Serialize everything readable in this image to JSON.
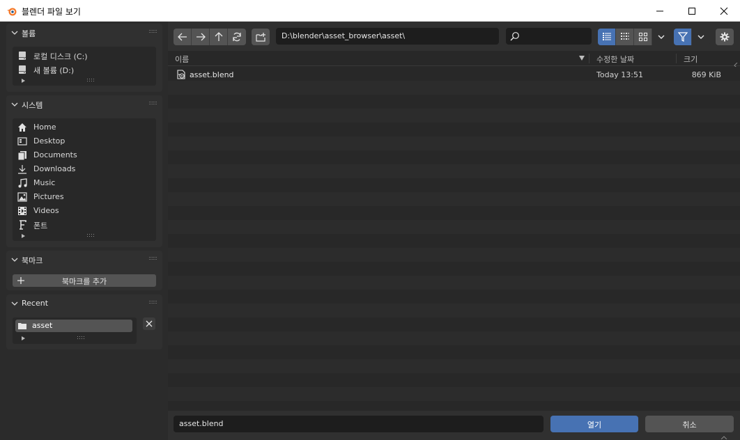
{
  "window": {
    "title": "블렌더 파일 보기",
    "controls": [
      "minimize-icon",
      "maximize-icon",
      "close-icon"
    ]
  },
  "sidebar": {
    "volumes": {
      "title": "볼륨",
      "items": [
        {
          "label": "로컬 디스크 (C:)",
          "icon": "drive-icon"
        },
        {
          "label": "새 볼륨 (D:)",
          "icon": "drive-icon"
        }
      ]
    },
    "system": {
      "title": "시스템",
      "items": [
        {
          "label": "Home",
          "icon": "home-icon"
        },
        {
          "label": "Desktop",
          "icon": "desktop-icon"
        },
        {
          "label": "Documents",
          "icon": "documents-icon"
        },
        {
          "label": "Downloads",
          "icon": "downloads-icon"
        },
        {
          "label": "Music",
          "icon": "music-icon"
        },
        {
          "label": "Pictures",
          "icon": "pictures-icon"
        },
        {
          "label": "Videos",
          "icon": "videos-icon"
        },
        {
          "label": "폰트",
          "icon": "font-icon"
        }
      ]
    },
    "bookmarks": {
      "title": "북마크",
      "add_label": "북마크를 추가"
    },
    "recent": {
      "title": "Recent",
      "items": [
        {
          "label": "asset",
          "icon": "folder-icon"
        }
      ]
    }
  },
  "toolbar": {
    "path": "D:\\blender\\asset_browser\\asset\\",
    "search_placeholder": "",
    "view_mode": "vertical-list"
  },
  "columns": {
    "name": "이름",
    "modified": "수정한 날짜",
    "size": "크기"
  },
  "files": [
    {
      "name": "asset.blend",
      "date": "Today 13:51",
      "size": "869 KiB",
      "icon": "blend-file-icon"
    }
  ],
  "footer": {
    "filename": "asset.blend",
    "open_label": "열기",
    "cancel_label": "취소"
  },
  "colors": {
    "accent": "#4772b3",
    "background": "#282828",
    "panel": "#303030"
  }
}
